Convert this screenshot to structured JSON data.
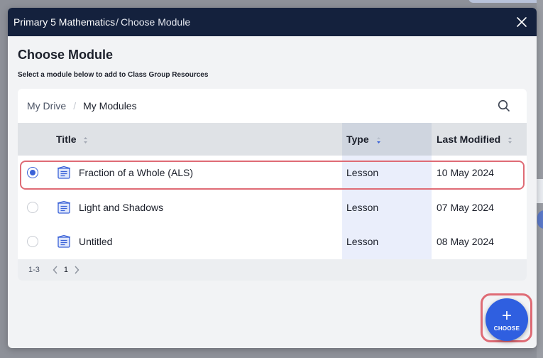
{
  "window": {
    "breadcrumb_root": "Primary 5 Mathematics",
    "breadcrumb_sep": "/",
    "breadcrumb_current": "Choose Module"
  },
  "dialog": {
    "heading": "Choose Module",
    "subheading": "Select a module below to add to Class Group Resources"
  },
  "drive": {
    "root": "My Drive",
    "sep": "/",
    "current": "My Modules"
  },
  "table": {
    "columns": {
      "title": "Title",
      "type": "Type",
      "modified": "Last Modified"
    },
    "rows": [
      {
        "title": "Fraction of a Whole (ALS)",
        "type": "Lesson",
        "modified": "10 May 2024",
        "selected": true
      },
      {
        "title": "Light and Shadows",
        "type": "Lesson",
        "modified": "07 May 2024",
        "selected": false
      },
      {
        "title": "Untitled",
        "type": "Lesson",
        "modified": "08 May 2024",
        "selected": false
      }
    ]
  },
  "pager": {
    "range": "1-3",
    "page": "1"
  },
  "fab": {
    "plus": "+",
    "label": "CHOOSE"
  },
  "colors": {
    "titlebar": "#14213d",
    "accent": "#3a62d8",
    "highlight": "#df6b75",
    "fab": "#2f5fe0"
  }
}
